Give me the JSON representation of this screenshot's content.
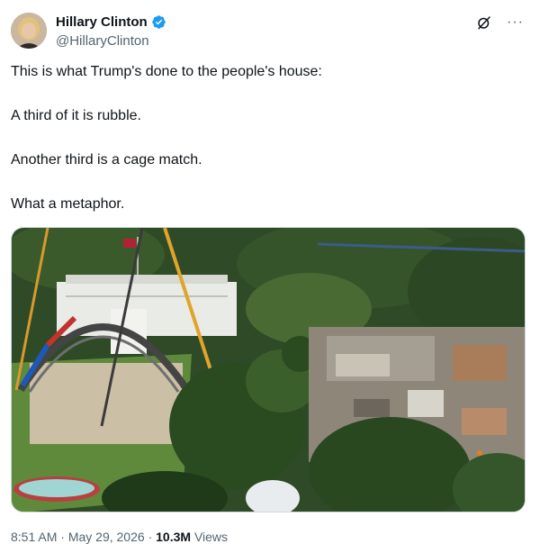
{
  "author": {
    "display_name": "Hillary Clinton",
    "handle": "@HillaryClinton",
    "verified": true,
    "verified_color": "#1d9bf0"
  },
  "actions": {
    "grok_icon": "grok-icon",
    "more_icon": "more-icon",
    "more_glyph": "···"
  },
  "tweet": {
    "lines": [
      "This is what Trump's done to the people's house:",
      "A third of it is rubble.",
      "Another third is a cage match.",
      "What a metaphor."
    ]
  },
  "media": {
    "alt": "Aerial photo of the White House grounds: a stage with arched truss and cranes on the South Lawn, trees, and a large construction demolition site to the right."
  },
  "meta": {
    "time": "8:51 AM",
    "separator": "·",
    "date": "May 29, 2026",
    "views_count": "10.3M",
    "views_label": "Views"
  }
}
